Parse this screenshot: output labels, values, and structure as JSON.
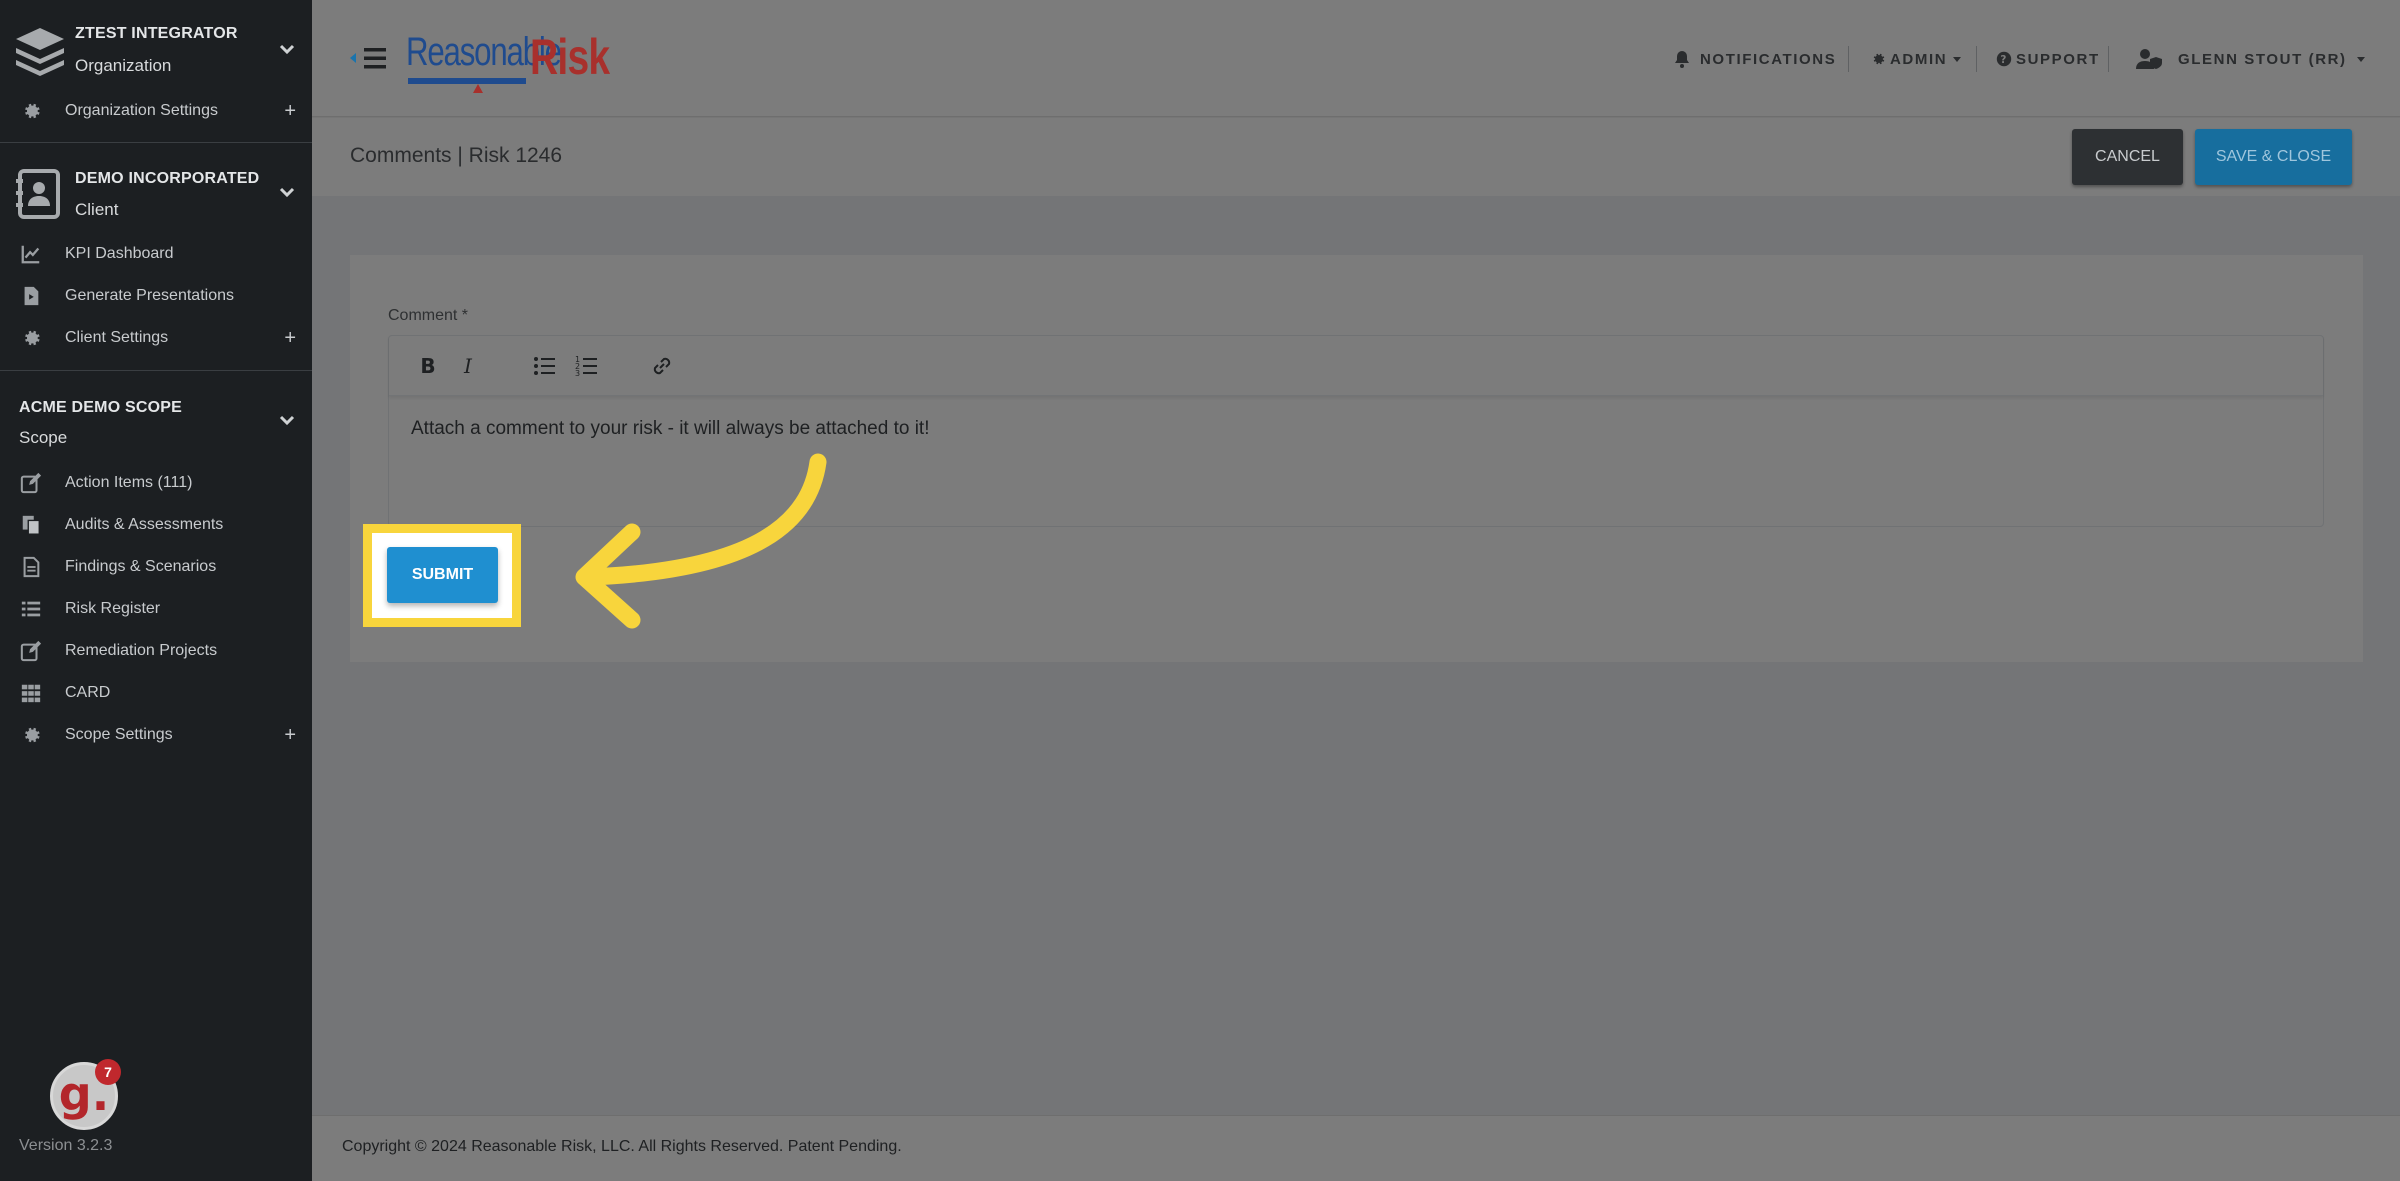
{
  "sidebar": {
    "org": {
      "title": "ZTEST INTEGRATOR",
      "subtitle": "Organization"
    },
    "org_settings": "Organization Settings",
    "client": {
      "title": "DEMO INCORPORATED",
      "subtitle": "Client"
    },
    "client_items": [
      "KPI Dashboard",
      "Generate Presentations",
      "Client Settings"
    ],
    "scope": {
      "title": "ACME DEMO SCOPE",
      "subtitle": "Scope"
    },
    "scope_items": [
      "Action Items (111)",
      "Audits & Assessments",
      "Findings & Scenarios",
      "Risk Register",
      "Remediation Projects",
      "CARD",
      "Scope Settings"
    ],
    "badge_letter": "g.",
    "badge_count": "7",
    "version": "Version 3.2.3"
  },
  "topbar": {
    "logo_left": "Reasonable",
    "logo_right": "Risk",
    "notifications": "NOTIFICATIONS",
    "admin": "ADMIN",
    "support": "SUPPORT",
    "user": "GLENN STOUT (RR)"
  },
  "page": {
    "title": "Comments | Risk 1246",
    "cancel": "CANCEL",
    "save_close": "SAVE & CLOSE"
  },
  "form": {
    "comment_label": "Comment *",
    "comment_text": "Attach a comment to your risk - it will always be attached to it!",
    "submit": "SUBMIT"
  },
  "footer": "Copyright © 2024 Reasonable Risk, LLC. All Rights Reserved. Patent Pending.",
  "colors": {
    "highlight": "#f8d53c",
    "submit": "#1f8fd0",
    "save": "#176e9e",
    "brand_red": "#a8302c",
    "brand_blue": "#1f4b8e"
  }
}
